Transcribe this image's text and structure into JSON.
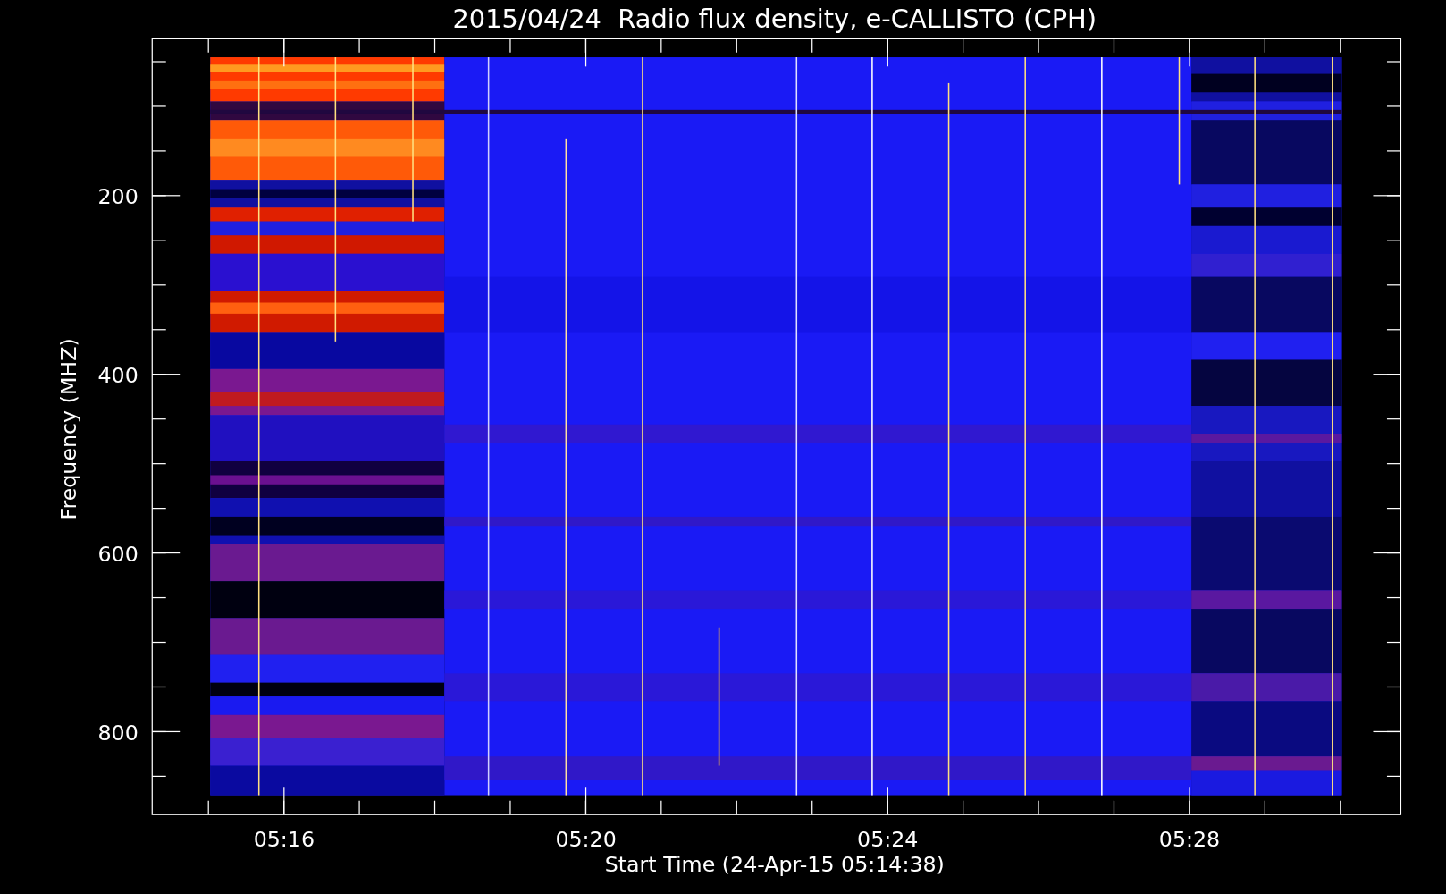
{
  "title": "2015/04/24  Radio flux density, e-CALLISTO (CPH)",
  "y_axis": {
    "label": "Frequency (MHZ)",
    "ticks": [
      "200",
      "400",
      "600",
      "800"
    ]
  },
  "x_axis": {
    "label": "Start Time (24-Apr-15 05:14:38)",
    "ticks": [
      "05:16",
      "05:20",
      "05:24",
      "05:28"
    ]
  }
}
